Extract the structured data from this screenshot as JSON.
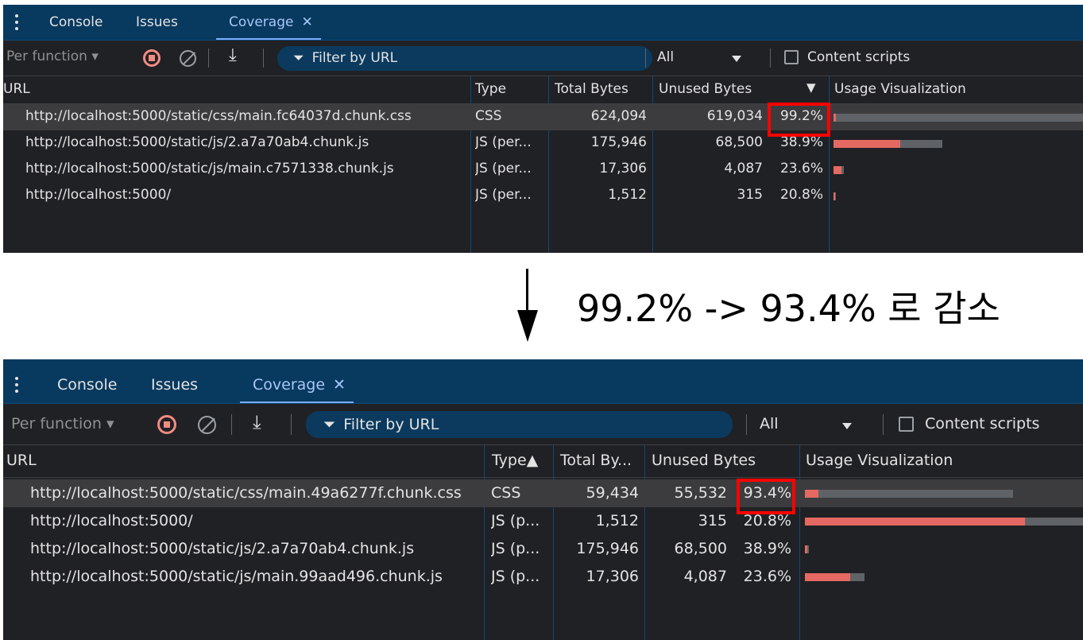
{
  "caption": "99.2% -> 93.4% 로 감소",
  "colors": {
    "used": "#e46962",
    "unused": "#5f6368",
    "highlight": "#ff0000",
    "tabbar": "#08395f"
  },
  "before": {
    "tabs": [
      {
        "label": "Console"
      },
      {
        "label": "Issues"
      },
      {
        "label": "Coverage"
      }
    ],
    "toolbar": {
      "mode": "Per function",
      "filter_placeholder": "Filter by URL",
      "type_select": "All",
      "content_scripts": "Content scripts"
    },
    "columns": {
      "url": "URL",
      "type": "Type",
      "total": "Total Bytes",
      "unused": "Unused Bytes",
      "usage": "Usage Visualization"
    },
    "rows": [
      {
        "url": "http://localhost:5000/static/css/main.fc64037d.chunk.css",
        "type": "CSS",
        "total": "624,094",
        "unused": "619,034",
        "pct": "99.2%",
        "used_frac": 0.008,
        "unused_frac": 0.992
      },
      {
        "url": "http://localhost:5000/static/js/2.a7a70ab4.chunk.js",
        "type": "JS (per...",
        "total": "175,946",
        "unused": "68,500",
        "pct": "38.9%",
        "used_frac": 0.611,
        "unused_frac": 0.389
      },
      {
        "url": "http://localhost:5000/static/js/main.c7571338.chunk.js",
        "type": "JS (per...",
        "total": "17,306",
        "unused": "4,087",
        "pct": "23.6%",
        "used_frac": 0.764,
        "unused_frac": 0.236
      },
      {
        "url": "http://localhost:5000/",
        "type": "JS (per...",
        "total": "1,512",
        "unused": "315",
        "pct": "20.8%",
        "used_frac": 0.792,
        "unused_frac": 0.208
      }
    ]
  },
  "after": {
    "tabs": [
      {
        "label": "Console"
      },
      {
        "label": "Issues"
      },
      {
        "label": "Coverage"
      }
    ],
    "toolbar": {
      "mode": "Per function",
      "filter_placeholder": "Filter by URL",
      "type_select": "All",
      "content_scripts": "Content scripts"
    },
    "columns": {
      "url": "URL",
      "type": "Type▲",
      "total": "Total By...",
      "unused": "Unused Bytes",
      "usage": "Usage Visualization"
    },
    "rows": [
      {
        "url": "http://localhost:5000/static/css/main.49a6277f.chunk.css",
        "type": "CSS",
        "total": "59,434",
        "unused": "55,532",
        "pct": "93.4%",
        "used_frac": 0.066,
        "unused_frac": 0.934
      },
      {
        "url": "http://localhost:5000/",
        "type": "JS (p...",
        "total": "1,512",
        "unused": "315",
        "pct": "20.8%",
        "used_frac": 0.792,
        "unused_frac": 0.208
      },
      {
        "url": "http://localhost:5000/static/js/2.a7a70ab4.chunk.js",
        "type": "JS (p...",
        "total": "175,946",
        "unused": "68,500",
        "pct": "38.9%",
        "used_frac": 0.611,
        "unused_frac": 0.389
      },
      {
        "url": "http://localhost:5000/static/js/main.99aad496.chunk.js",
        "type": "JS (p...",
        "total": "17,306",
        "unused": "4,087",
        "pct": "23.6%",
        "used_frac": 0.764,
        "unused_frac": 0.236
      }
    ]
  }
}
